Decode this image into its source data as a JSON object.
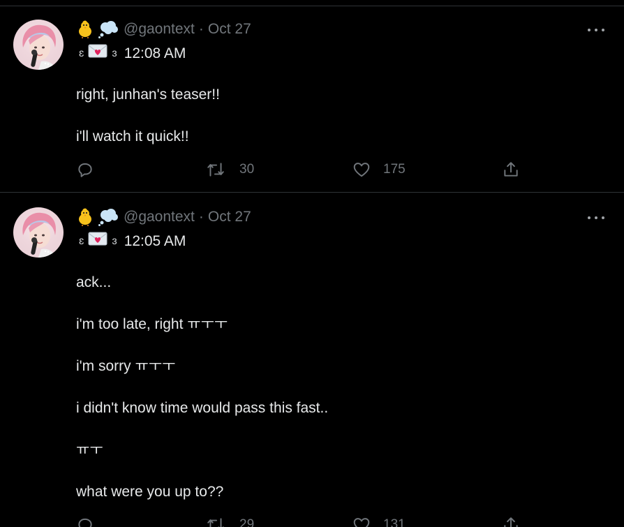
{
  "tweets": [
    {
      "handle": "@gaontext",
      "date": "Oct 27",
      "bracket_left": "ɛ",
      "bracket_right": "ɜ",
      "time": "12:08 AM",
      "lines": [
        "right, junhan's teaser!!",
        "i'll watch it quick!!"
      ],
      "retweets": "30",
      "likes": "175"
    },
    {
      "handle": "@gaontext",
      "date": "Oct 27",
      "bracket_left": "ɛ",
      "bracket_right": "ɜ",
      "time": "12:05 AM",
      "lines": [
        "ack...",
        "i'm too late, right ㅠㅜㅜ",
        "i'm sorry ㅠㅜㅜ",
        "i didn't know time would pass this fast..",
        "ㅠㅜ",
        "what were you up to??"
      ],
      "retweets": "29",
      "likes": "131"
    }
  ],
  "separator": "·",
  "icons": {
    "emoji_1": "chick-emoji-icon",
    "emoji_2": "thought-balloon-emoji-icon",
    "envelope": "love-letter-icon",
    "reply": "reply-icon",
    "retweet": "retweet-icon",
    "like": "heart-icon",
    "share": "share-icon",
    "more": "more-icon"
  },
  "colors": {
    "background": "#000000",
    "text": "#e7e9ea",
    "secondary": "#71767b",
    "divider": "#2f3336"
  }
}
